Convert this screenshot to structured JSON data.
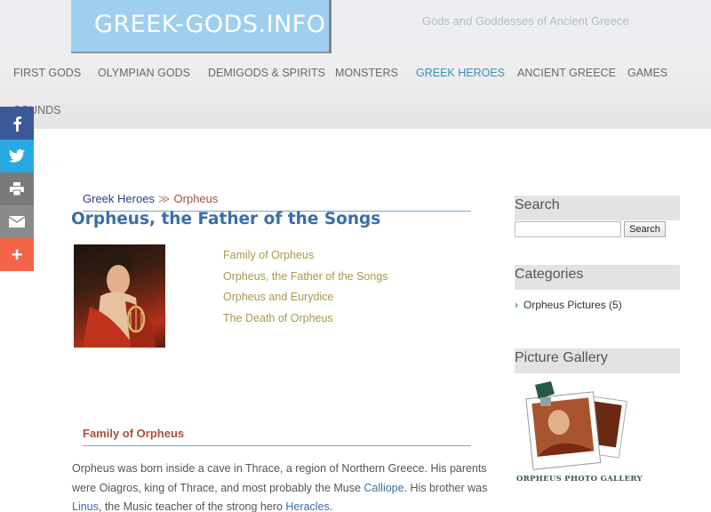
{
  "header": {
    "logo": "GREEK-GODS.INFO",
    "tagline": "Gods and Goddesses of Ancient Greece"
  },
  "nav": [
    {
      "label": "FIRST GODS"
    },
    {
      "label": "OLYMPIAN GODS"
    },
    {
      "label": "DEMIGODS & SPIRITS"
    },
    {
      "label": "MONSTERS"
    },
    {
      "label": "GREEK HEROES",
      "active": true
    },
    {
      "label": "ANCIENT GREECE"
    },
    {
      "label": "GAMES"
    },
    {
      "label": "SOUNDS"
    }
  ],
  "social": [
    "facebook-icon",
    "twitter-icon",
    "print-icon",
    "email-icon",
    "plus-icon"
  ],
  "breadcrumb": {
    "parent": "Greek Heroes",
    "separator": "≫",
    "current": "Orpheus"
  },
  "page_title": "Orpheus, the Father of the Songs",
  "toc": [
    "Family of Orpheus",
    "Orpheus, the Father of the Songs",
    "Orpheus and Eurydice",
    "The Death of Orpheus"
  ],
  "section": {
    "title": "Family of Orpheus",
    "p1": "Orpheus was born inside a cave in Thrace, a region of Northern Greece. His parents were Oiagros, king of Thrace, and most probably the Muse ",
    "link1": "Calliope",
    "p2": ". His brother was ",
    "link2": "Linus",
    "p3": ", the Music teacher of the strong hero ",
    "link3": "Heracles",
    "p4": "."
  },
  "sidebar": {
    "search_title": "Search",
    "search_button": "Search",
    "categories_title": "Categories",
    "category_item": "Orpheus Pictures (5)",
    "gallery_title": "Picture Gallery",
    "gallery_caption": "ORPHEUS PHOTO GALLERY"
  },
  "colors": {
    "logo_bg": "#9ecfee",
    "nav_active": "#3d8fb8",
    "link": "#3a6ea8",
    "toc_link": "#a79a4d",
    "section_title": "#a7513c"
  }
}
